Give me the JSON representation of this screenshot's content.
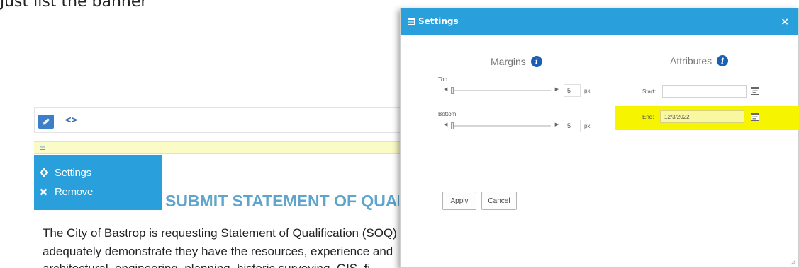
{
  "caption": "just list the banner",
  "editor": {
    "menu": {
      "settings_label": "Settings",
      "remove_label": "Remove"
    }
  },
  "document": {
    "heading": "SUBMIT STATEMENT OF QUALIFICATIONS",
    "lines": [
      "The City of Bastrop is requesting Statement of Qualification (SOQ)",
      "adequately demonstrate they have the resources, experience and",
      "architectural, engineering, planning, historic surveying, GIS, fi"
    ]
  },
  "modal": {
    "title": "Settings",
    "close_label": "×",
    "margins": {
      "title": "Margins",
      "top_label": "Top",
      "top_value": "5",
      "bottom_label": "Bottom",
      "bottom_value": "5",
      "unit": "px"
    },
    "attributes": {
      "title": "Attributes",
      "start_label": "Start:",
      "start_value": "",
      "end_label": "End:",
      "end_value": "12/3/2022"
    },
    "apply_label": "Apply",
    "cancel_label": "Cancel"
  },
  "colors": {
    "accent": "#29a0dc",
    "highlight": "#f7f400",
    "info_icon": "#1a5fb4",
    "heading_text": "#5ea4cc"
  }
}
